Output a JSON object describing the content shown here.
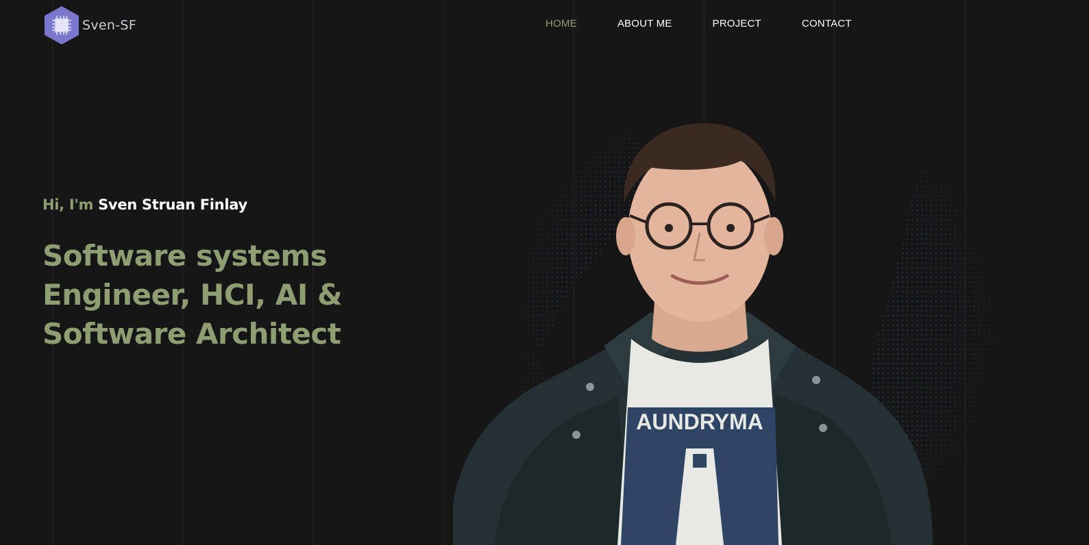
{
  "brand": {
    "logo_text": "Sven-SF",
    "logo_icon": "cpu-chip-hexagon-icon",
    "logo_color": "#7b77cc"
  },
  "nav": {
    "items": [
      {
        "label": "HOME",
        "active": true
      },
      {
        "label": "ABOUT ME",
        "active": false
      },
      {
        "label": "PROJECT",
        "active": false
      },
      {
        "label": "CONTACT",
        "active": false
      }
    ]
  },
  "hero": {
    "greeting_prefix": "Hi, I'm",
    "name": "Sven Struan Finlay",
    "headline_lines": [
      "Software systems",
      "Engineer, HCI, AI &",
      "Software Architect"
    ]
  },
  "colors": {
    "background": "#161616",
    "accent": "#8f9e72",
    "text": "#ffffff",
    "globe_dots": "#2a3a5c"
  }
}
